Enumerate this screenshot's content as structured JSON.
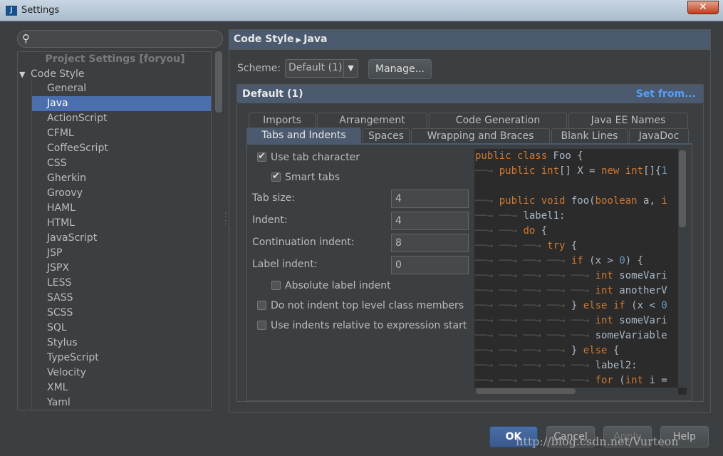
{
  "window": {
    "title": "Settings",
    "app_icon": "J",
    "close_symbol": "✕"
  },
  "search": {
    "placeholder": ""
  },
  "tree": {
    "header": "Project Settings [foryou]",
    "root": "Code Style",
    "items": [
      "General",
      "Java",
      "ActionScript",
      "CFML",
      "CoffeeScript",
      "CSS",
      "Gherkin",
      "Groovy",
      "HAML",
      "HTML",
      "JavaScript",
      "JSP",
      "JSPX",
      "LESS",
      "SASS",
      "SCSS",
      "SQL",
      "Stylus",
      "TypeScript",
      "Velocity",
      "XML",
      "Yaml"
    ],
    "selected": "Java"
  },
  "breadcrumb": {
    "parent": "Code Style",
    "current": "Java"
  },
  "scheme": {
    "label": "Scheme:",
    "value": "Default (1)",
    "manage_label": "Manage..."
  },
  "panel": {
    "title": "Default (1)",
    "set_from": "Set from..."
  },
  "tabs": {
    "row1": [
      "Imports",
      "Arrangement",
      "Code Generation",
      "Java EE Names"
    ],
    "row2": [
      "Tabs and Indents",
      "Spaces",
      "Wrapping and Braces",
      "Blank Lines",
      "JavaDoc"
    ],
    "active": "Tabs and Indents"
  },
  "options": {
    "use_tab_character": {
      "label": "Use tab character",
      "checked": true
    },
    "smart_tabs": {
      "label": "Smart tabs",
      "checked": true
    },
    "tab_size": {
      "label": "Tab size:",
      "value": "4"
    },
    "indent": {
      "label": "Indent:",
      "value": "4"
    },
    "continuation_indent": {
      "label": "Continuation indent:",
      "value": "8"
    },
    "label_indent": {
      "label": "Label indent:",
      "value": "0"
    },
    "absolute_label_indent": {
      "label": "Absolute label indent",
      "checked": false
    },
    "no_indent_top_level": {
      "label": "Do not indent top level class members",
      "checked": false
    },
    "relative_indents": {
      "label": "Use indents relative to expression start",
      "checked": false
    }
  },
  "code_preview": [
    [
      0,
      [
        [
          "kw",
          "public class "
        ],
        [
          "",
          "Foo {"
        ]
      ]
    ],
    [
      1,
      [
        [
          "kw",
          "public "
        ],
        [
          "kw",
          "int"
        ],
        [
          "",
          "[] X = "
        ],
        [
          "kw",
          "new "
        ],
        [
          "kw",
          "int"
        ],
        [
          "",
          "[]{"
        ],
        [
          "num",
          "1"
        ]
      ]
    ],
    [
      0,
      []
    ],
    [
      1,
      [
        [
          "kw",
          "public void "
        ],
        [
          "",
          "foo("
        ],
        [
          "kw",
          "boolean "
        ],
        [
          "",
          "a, "
        ],
        [
          "kw",
          "i"
        ]
      ]
    ],
    [
      2,
      [
        [
          "",
          "label1:"
        ]
      ]
    ],
    [
      2,
      [
        [
          "kw",
          "do "
        ],
        [
          "",
          "{"
        ]
      ]
    ],
    [
      3,
      [
        [
          "kw",
          "try "
        ],
        [
          "",
          "{"
        ]
      ]
    ],
    [
      4,
      [
        [
          "kw",
          "if "
        ],
        [
          "",
          "(x > "
        ],
        [
          "num",
          "0"
        ],
        [
          "",
          ") {"
        ]
      ]
    ],
    [
      5,
      [
        [
          "kw",
          "int "
        ],
        [
          "",
          "someVari"
        ]
      ]
    ],
    [
      5,
      [
        [
          "kw",
          "int "
        ],
        [
          "",
          "anotherV"
        ]
      ]
    ],
    [
      4,
      [
        [
          "",
          "} "
        ],
        [
          "kw",
          "else if "
        ],
        [
          "",
          "(x < "
        ],
        [
          "num",
          "0"
        ]
      ]
    ],
    [
      5,
      [
        [
          "kw",
          "int "
        ],
        [
          "",
          "someVari"
        ]
      ]
    ],
    [
      5,
      [
        [
          "",
          "someVariable"
        ]
      ]
    ],
    [
      4,
      [
        [
          "",
          "} "
        ],
        [
          "kw",
          "else "
        ],
        [
          "",
          "{"
        ]
      ]
    ],
    [
      5,
      [
        [
          "",
          "label2:"
        ]
      ]
    ],
    [
      5,
      [
        [
          "kw",
          "for "
        ],
        [
          "",
          "("
        ],
        [
          "kw",
          "int "
        ],
        [
          "",
          "i ="
        ]
      ]
    ]
  ],
  "buttons": {
    "ok": "OK",
    "cancel": "Cancel",
    "apply": "Apply",
    "help": "Help"
  },
  "watermark": "http://blog.csdn.net/Vurteon",
  "colors": {
    "accent": "#4b6eaf",
    "keyword": "#cc7832",
    "number": "#6897bb",
    "link": "#589df6"
  }
}
